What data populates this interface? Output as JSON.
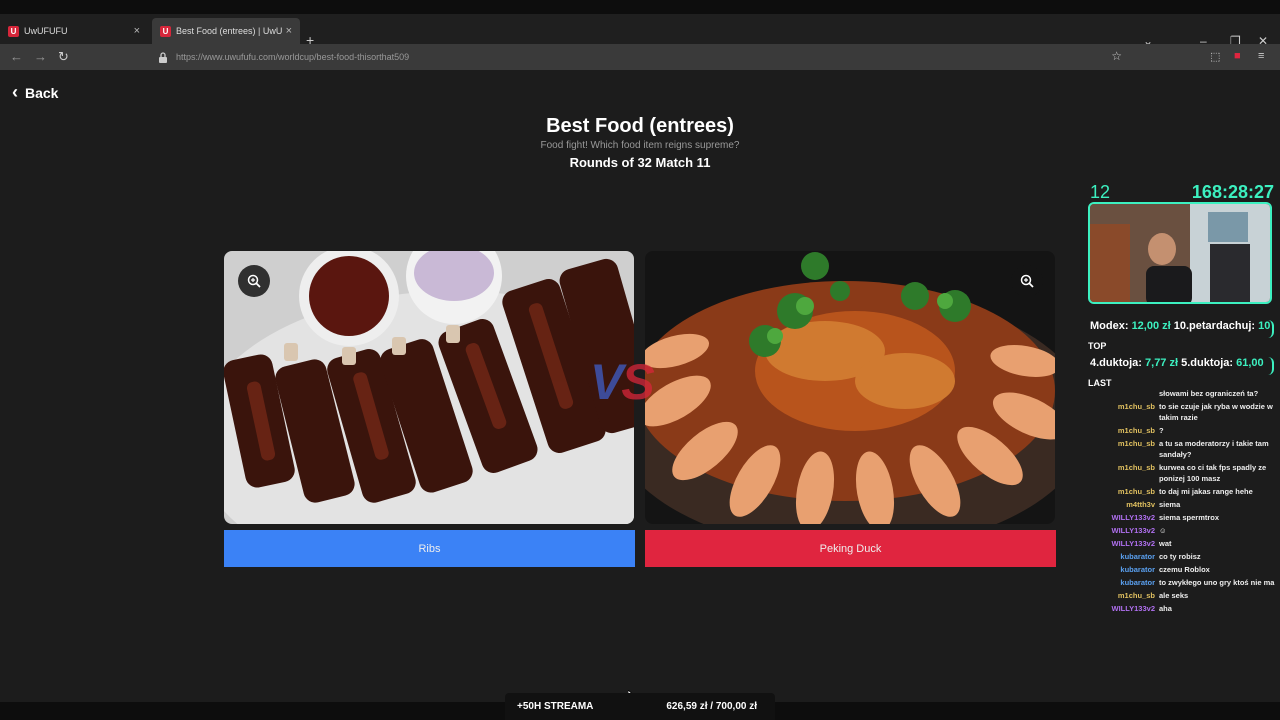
{
  "browser": {
    "tabs": [
      {
        "favicon": "U",
        "label": "UwUFUFU",
        "close": "×"
      },
      {
        "favicon": "U",
        "label": "Best Food (entrees) | UwUFUFU",
        "close": "×"
      }
    ],
    "new_tab": "+",
    "url": "https://www.uwufufu.com/worldcup/best-food-thisorthat509"
  },
  "page": {
    "back_label": "Back",
    "title": "Best Food (entrees)",
    "subtitle": "Food fight! Which food item reigns supreme?",
    "round_info": "Rounds of 32 Match 11",
    "vs_v": "V",
    "vs_s": "S",
    "left_choice": "Ribs",
    "right_choice": "Peking Duck"
  },
  "overlay": {
    "count": "12",
    "timer": "168:28:27",
    "top_donation": {
      "name": "Modex:",
      "amount": "12,00 zł",
      "next": "10.petardachuj:",
      "next_amount": "10"
    },
    "last_donation": {
      "name": "4.duktoja:",
      "amount": "7,77 zł",
      "next": "5.duktoja:",
      "next_amount": "61,00"
    },
    "tag_top": "TOP",
    "tag_last": "LAST"
  },
  "chat": [
    {
      "user": "",
      "msg": "słowami bez ograniczeń ta?",
      "color": "#e0d080"
    },
    {
      "user": "m1chu_sb",
      "msg": "to sie czuje jak ryba w wodzie w takim razie",
      "color": "#e0c060"
    },
    {
      "user": "m1chu_sb",
      "msg": "?",
      "color": "#e0c060"
    },
    {
      "user": "m1chu_sb",
      "msg": "a tu sa moderatorzy i takie tam sandały?",
      "color": "#e0c060"
    },
    {
      "user": "m1chu_sb",
      "msg": "kurwea co ci tak fps spadly ze ponizej 100 masz",
      "color": "#e0c060"
    },
    {
      "user": "m1chu_sb",
      "msg": "to daj mi jakas range hehe",
      "color": "#e0c060"
    },
    {
      "user": "m4tth3v",
      "msg": "siema",
      "color": "#e0c060"
    },
    {
      "user": "WILLY133v2",
      "msg": "siema spermtrox",
      "color": "#b070f0"
    },
    {
      "user": "WILLY133v2",
      "msg": "☺",
      "color": "#b070f0"
    },
    {
      "user": "WILLY133v2",
      "msg": "wat",
      "color": "#b070f0"
    },
    {
      "user": "kubarator",
      "msg": "co ty robisz",
      "color": "#5aa0f0"
    },
    {
      "user": "kubarator",
      "msg": "czemu Roblox",
      "color": "#5aa0f0"
    },
    {
      "user": "kubarator",
      "msg": "to zwykłego uno gry ktoś nie ma",
      "color": "#5aa0f0"
    },
    {
      "user": "m1chu_sb",
      "msg": "ale seks",
      "color": "#e0c060"
    },
    {
      "user": "WILLY133v2",
      "msg": "aha",
      "color": "#b070f0"
    }
  ],
  "stream_bar": {
    "label": "+50H STREAMA",
    "progress": "626,59 zł / 700,00 zł"
  }
}
